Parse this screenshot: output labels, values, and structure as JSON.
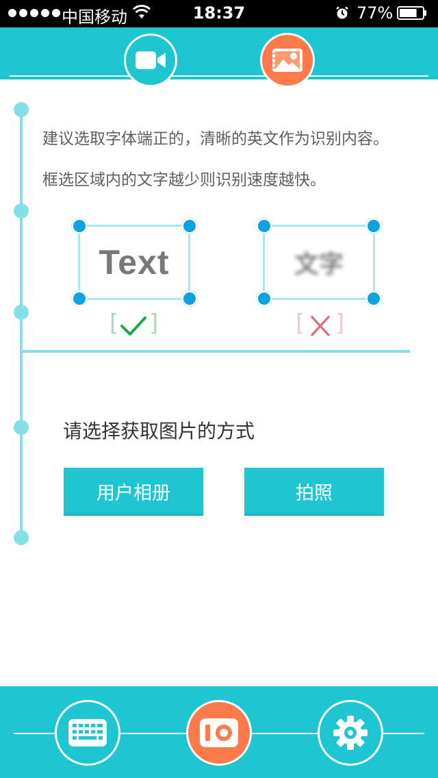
{
  "status_bar": {
    "carrier": "中国移动",
    "time": "18:37",
    "battery_percent": "77%",
    "battery_level": 0.77,
    "signal_bars": 5
  },
  "top_tabs": [
    {
      "name": "video",
      "icon": "video-camera-icon"
    },
    {
      "name": "image",
      "icon": "image-icon"
    }
  ],
  "tips": {
    "line1": "建议选取字体端正的，清晰的英文作为识别内容。",
    "line2": "框选区域内的文字越少则识别速度越快。"
  },
  "examples": {
    "good_text": "Text",
    "bad_text": "文字",
    "good_open": "[",
    "good_close": "]",
    "bad_open": "[",
    "bad_close": "]"
  },
  "prompt": "请选择获取图片的方式",
  "buttons": {
    "album": "用户相册",
    "photo": "拍照"
  },
  "bottom_nav": [
    {
      "name": "keyboard",
      "icon": "keyboard-icon"
    },
    {
      "name": "camera",
      "icon": "camera-icon"
    },
    {
      "name": "settings",
      "icon": "gear-icon"
    }
  ],
  "colors": {
    "accent": "#1ec6d2",
    "orange": "#fe7a4a",
    "timeline": "#84dfe6",
    "handle": "#0ea1e0",
    "good": "#1aa84a",
    "bad": "#e0707a"
  }
}
